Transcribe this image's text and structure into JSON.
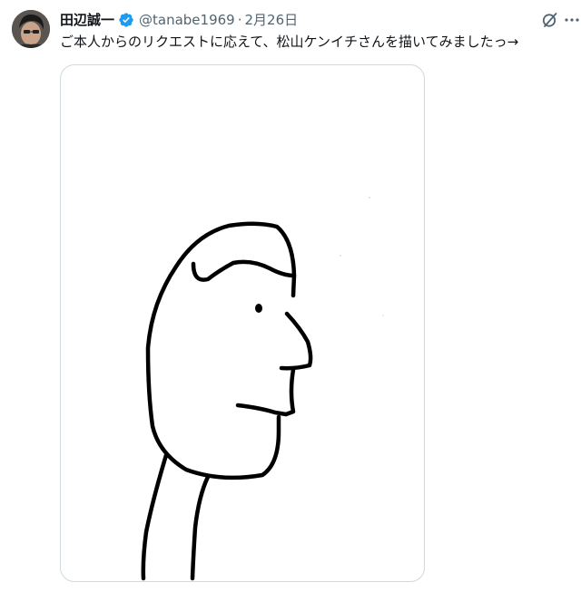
{
  "tweet": {
    "author_name": "田辺誠一",
    "handle": "@tanabe1969",
    "separator": "·",
    "time": "2月26日",
    "text": "ご本人からのリクエストに応えて、松山ケンイチさんを描いてみましたっ→"
  },
  "icons": {
    "verified": "verified-badge-icon",
    "grok": "grok-icon",
    "more": "more-horizontal-icon"
  },
  "colors": {
    "verified_blue": "#1d9bf0",
    "secondary_text": "#536471",
    "primary_text": "#0f1419",
    "card_border": "#cfd9de"
  }
}
